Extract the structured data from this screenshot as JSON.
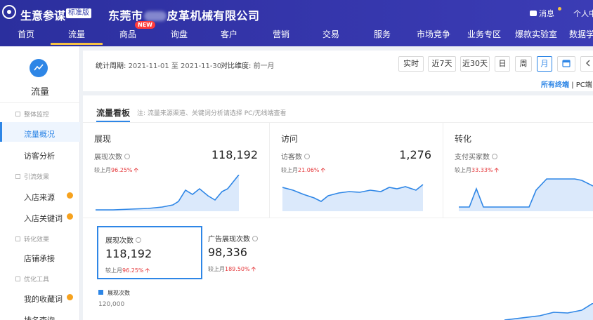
{
  "header": {
    "brand": "生意参谋",
    "edition": "标准版",
    "company_prefix": "东莞市",
    "company_suffix": "皮革机械有限公司",
    "messages": "消息",
    "personal": "个人中"
  },
  "nav": {
    "items": [
      "首页",
      "流量",
      "商品",
      "询盘",
      "客户",
      "营销",
      "交易",
      "服务",
      "市场竞争",
      "业务专区",
      "爆款实验室",
      "数据学"
    ],
    "active": "流量",
    "new_badge": "NEW"
  },
  "sidebar": {
    "title": "流量",
    "icon": "line-chart-icon",
    "groups": [
      {
        "label": "整体监控",
        "items": [
          {
            "label": "流量概况",
            "active": true
          },
          {
            "label": "访客分析"
          }
        ]
      },
      {
        "label": "引流效果",
        "items": [
          {
            "label": "入店来源",
            "dot": true
          },
          {
            "label": "入店关键词",
            "dot": true
          }
        ]
      },
      {
        "label": "转化效果",
        "items": [
          {
            "label": "店铺承接"
          }
        ]
      },
      {
        "label": "优化工具",
        "items": [
          {
            "label": "我的收藏词",
            "dot": true
          },
          {
            "label": "排名查询"
          }
        ]
      }
    ]
  },
  "filter": {
    "period_label": "统计周期:",
    "period_value": "2021-11-01 至 2021-11-30",
    "compare_label": "对比维度:",
    "compare_value": "前一月",
    "buttons": [
      "实时",
      "近7天",
      "近30天",
      "日",
      "周",
      "月"
    ],
    "active_button": "月",
    "calendar_icon": "calendar-icon",
    "prev_icon": "chevron-left-icon",
    "terminal_all": "所有终端",
    "terminal_sep": "|",
    "terminal_pc": "PC端"
  },
  "dashboard": {
    "title": "流量看板",
    "note": "注: 流量来源渠道、关键词分析请选择 PC/无线端查看",
    "cards": [
      {
        "title": "展现",
        "metric": "展现次数",
        "value": "118,192",
        "compare_prefix": "较上月",
        "compare_pct": "96.25%"
      },
      {
        "title": "访问",
        "metric": "访客数",
        "value": "1,276",
        "compare_prefix": "较上月",
        "compare_pct": "21.06%"
      },
      {
        "title": "转化",
        "metric": "支付买家数",
        "value": "",
        "compare_prefix": "较上月",
        "compare_pct": "33.33%"
      }
    ],
    "metric_boxes": [
      {
        "label": "展现次数",
        "value": "118,192",
        "compare_prefix": "较上月",
        "compare_pct": "96.25%",
        "selected": true
      },
      {
        "label": "广告展现次数",
        "value": "98,336",
        "compare_prefix": "较上月",
        "compare_pct": "189.50%",
        "selected": false
      }
    ],
    "chart_legend": "展现次数",
    "y_tick": "120,000",
    "accent": "#2e86e6",
    "up_color": "#e5383b"
  }
}
